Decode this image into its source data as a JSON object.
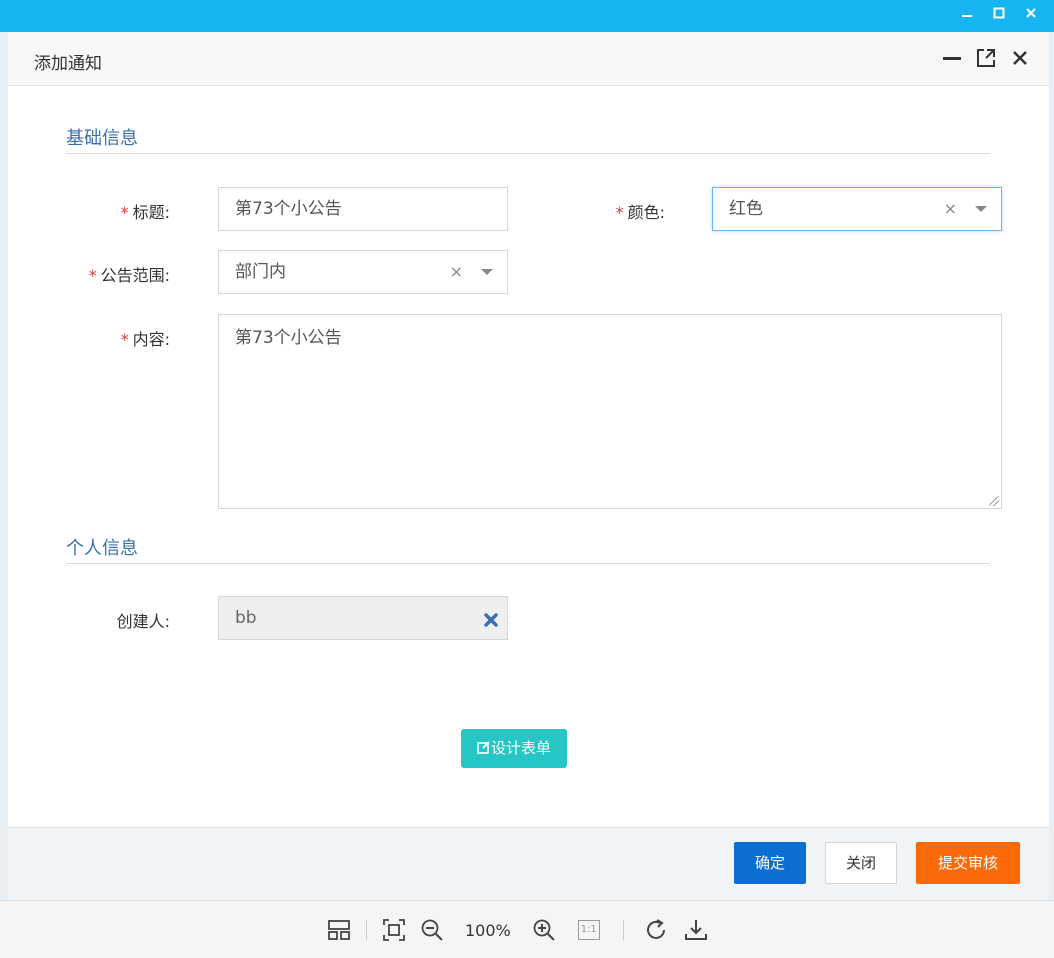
{
  "dialog": {
    "title": "添加通知"
  },
  "sections": {
    "basic": "基础信息",
    "personal": "个人信息"
  },
  "form": {
    "required_mark": "*",
    "title_label": "标题:",
    "title_value": "第73个小公告",
    "color_label": "颜色:",
    "color_value": "红色",
    "scope_label": "公告范围:",
    "scope_value": "部门内",
    "content_label": "内容:",
    "content_value": "第73个小公告",
    "creator_label": "创建人:",
    "creator_value": "bb",
    "clear_symbol": "×"
  },
  "buttons": {
    "design_form": "设计表单",
    "ok": "确定",
    "close": "关闭",
    "submit": "提交审核"
  },
  "viewer": {
    "zoom": "100%",
    "one_to_one": "1:1"
  },
  "colors": {
    "title_bar": "#16b5f2",
    "section": "#3a6fb0",
    "required": "#e4393c",
    "design_button": "#26c5c6",
    "ok_button": "#0a6fd0",
    "submit_button": "#fb6a09"
  }
}
